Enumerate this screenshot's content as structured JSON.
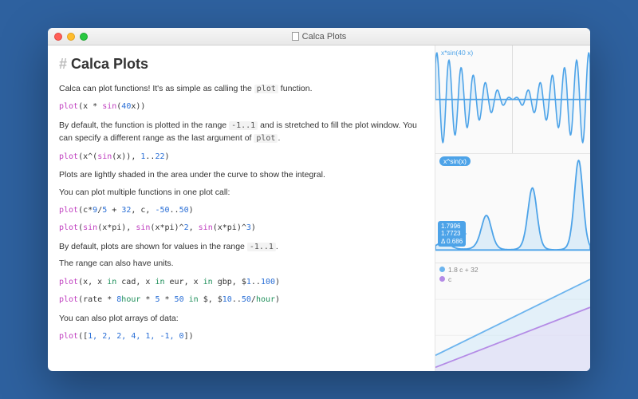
{
  "window": {
    "title": "Calca Plots"
  },
  "doc": {
    "heading": "Calca Plots",
    "p1": "Calca can plot functions! It's as simple as calling the ",
    "p1code": "plot",
    "p1after": " function.",
    "code1": {
      "fn": "plot",
      "body": "(x * ",
      "sin": "sin",
      "body2": "(",
      "n40": "40",
      "body3": "x))"
    },
    "p2a": "By default, the function is plotted in the range ",
    "p2range": "-1..1",
    "p2b": " and is stretched to fill the plot window. You can specify a different range as the last argument of ",
    "p2code": "plot",
    "p2c": ".",
    "code2": {
      "fn": "plot",
      "b1": "(x^(",
      "sin": "sin",
      "b2": "(x)), ",
      "n1": "1",
      "dots": "..",
      "n22": "22",
      "b3": ")"
    },
    "p3": "Plots are lightly shaded in the area under the curve to show the integral.",
    "p4": "You can plot multiple functions in one plot call:",
    "code3": {
      "fn": "plot",
      "b1": "(c*",
      "n9": "9",
      "slash": "/",
      "n5": "5",
      "plus": " + ",
      "n32": "32",
      "b2": ", c, ",
      "nm50": "-50",
      "dots": "..",
      "n50": "50",
      "b3": ")"
    },
    "code4": {
      "fn": "plot",
      "b1": "(",
      "sin": "sin",
      "b2": "(x*pi), ",
      "sin2": "sin",
      "b3": "(x*pi)^",
      "n2": "2",
      "b4": ", ",
      "sin3": "sin",
      "b5": "(x*pi)^",
      "n3": "3",
      "b6": ")"
    },
    "p5a": "By default, plots are shown for values in the range ",
    "p5range": "-1..1",
    "p5b": ".",
    "p6": "The range can also have units.",
    "code5": {
      "fn": "plot",
      "b1": "(x, x ",
      "in1": "in",
      "b2": " cad, x ",
      "in2": "in",
      "b3": " eur, x ",
      "in3": "in",
      "b4": " gbp, $",
      "n1": "1",
      "dots": "..",
      "n100": "100",
      "b5": ")"
    },
    "code6": {
      "fn": "plot",
      "b1": "(rate * ",
      "n8": "8",
      "hr": "hour",
      "b2": " * ",
      "n5": "5",
      "b3": " * ",
      "n50": "50",
      "b4": " ",
      "in": "in",
      "b5": " $, $",
      "n10": "10",
      "dots": "..",
      "n50b": "50",
      "slash": "/",
      "hr2": "hour",
      "b6": ")"
    },
    "p7": "You can also plot arrays of data:",
    "code7": {
      "fn": "plot",
      "b1": "([",
      "n": "1, 2, 2, 4, 1, -1, 0",
      "b2": "])"
    }
  },
  "plots": {
    "p1": {
      "label": "x*sin(40 x)"
    },
    "p2": {
      "label": "x^sin(x)",
      "tt1": "1.7996",
      "tt2": "1.7723",
      "tt3": "Δ 0.686"
    },
    "p3": {
      "legend1": "1.8 c + 32",
      "legend2": "c"
    }
  }
}
